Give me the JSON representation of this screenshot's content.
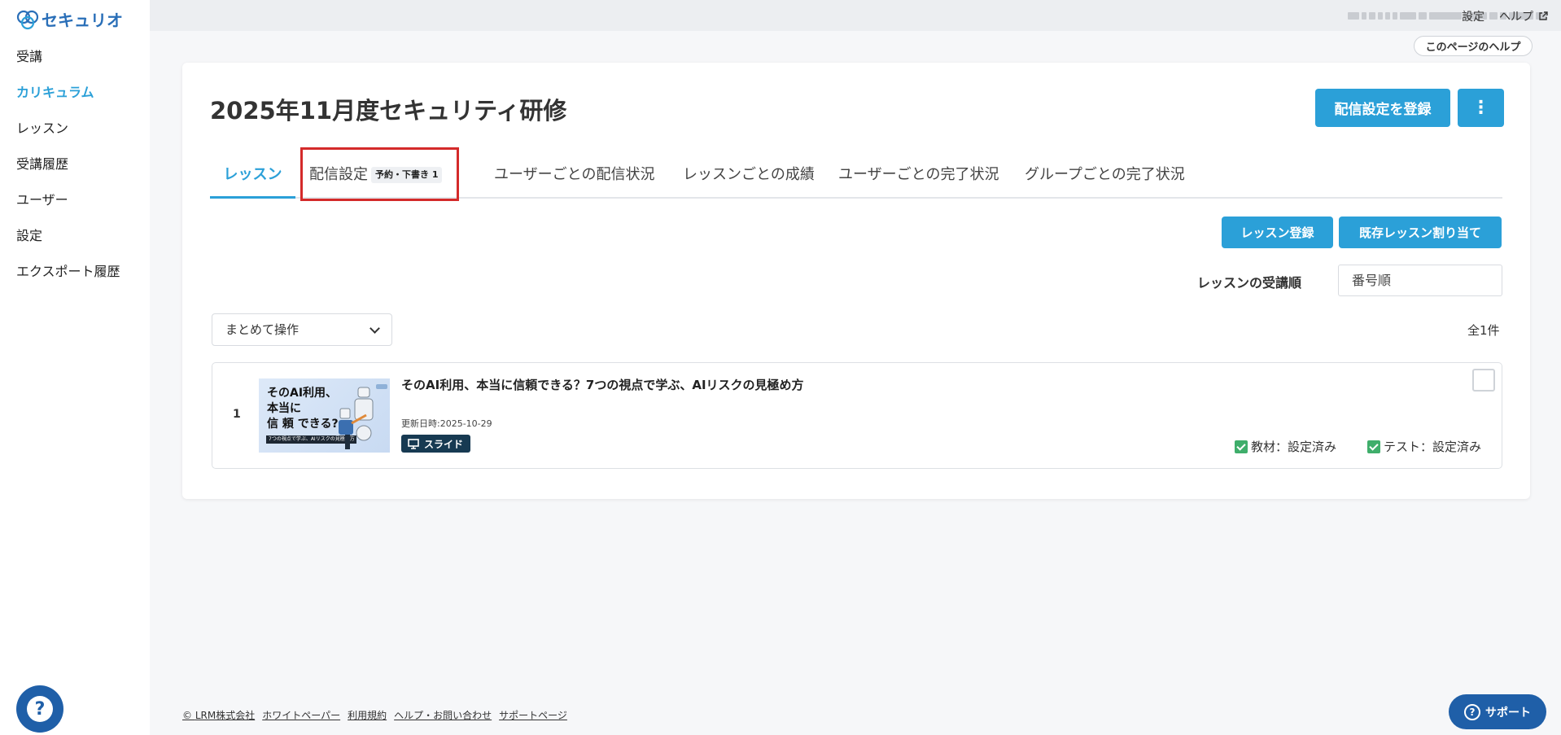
{
  "app": {
    "logo_text": "セキュリオ"
  },
  "sidebar": {
    "items": [
      {
        "label": "受講"
      },
      {
        "label": "カリキュラム",
        "active": true
      },
      {
        "label": "レッスン"
      },
      {
        "label": "受講履歴"
      },
      {
        "label": "ユーザー"
      },
      {
        "label": "設定"
      },
      {
        "label": "エクスポート履歴"
      }
    ],
    "help_glyph": "?"
  },
  "topbar": {
    "settings_label": "設定",
    "help_label": "ヘルプ",
    "page_help_label": "このページのヘルプ"
  },
  "main": {
    "title": "2025年11月度セキュリティ研修",
    "register_delivery_button": "配信設定を登録",
    "more_button": "⋮",
    "tabs": [
      {
        "label": "レッスン",
        "active": true
      },
      {
        "label": "配信設定",
        "badge": "予約・下書き 1"
      },
      {
        "label": "ユーザーごとの配信状況"
      },
      {
        "label": "レッスンごとの成績"
      },
      {
        "label": "ユーザーごとの完了状況"
      },
      {
        "label": "グループごとの完了状況"
      }
    ],
    "lesson_register_button": "レッスン登録",
    "assign_existing_button": "既存レッスン割り当て",
    "order_label": "レッスンの受講順",
    "order_value": "番号順",
    "bulk_action_label": "まとめて操作",
    "total_count": "全1件",
    "lessons": [
      {
        "number": "1",
        "thumb_title_line1": "そのAI利用、",
        "thumb_title_line2": "本当に",
        "thumb_title_line3": "信 頼 できる?",
        "thumb_strip": "7つの視点で学ぶ、AIリスクの見極め方",
        "title": "そのAI利用、本当に信頼できる？7つの視点で学ぶ、AIリスクの見極め方",
        "updated": "更新日時:2025-10-29",
        "type_badge": "スライド",
        "status_material": "教材：設定済み",
        "status_test": "テスト：設定済み"
      }
    ]
  },
  "footer": {
    "company": "LRM株式会社",
    "links": [
      "ホワイトペーパー",
      "利用規約",
      "ヘルプ・お問い合わせ",
      "サポートページ"
    ],
    "support_label": "サポート"
  },
  "colors": {
    "accent": "#2ba0d8",
    "brand_dark": "#1f5fa8",
    "highlight_box": "#d42a2a",
    "status_ok": "#3fae6b"
  }
}
